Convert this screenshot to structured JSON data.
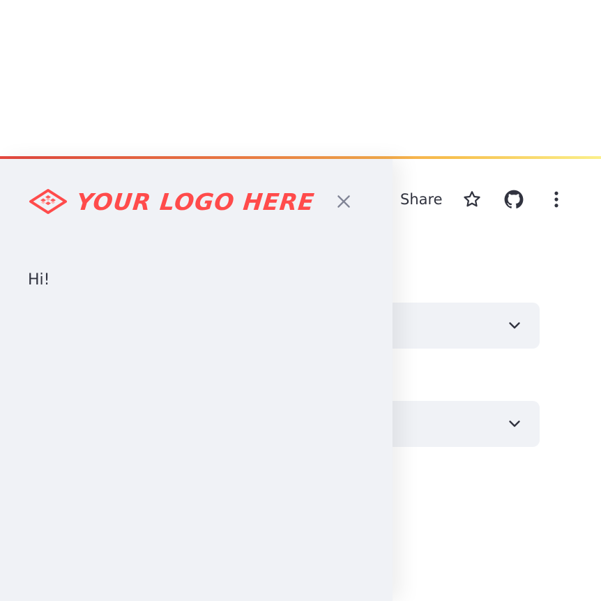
{
  "header": {
    "share_label": "Share",
    "icons": [
      "star-icon",
      "github-icon",
      "more-vertical-icon"
    ]
  },
  "sidebar": {
    "logo_text": "YOUR LOGO HERE",
    "close_icon": "close-icon",
    "content_text": "Hi!"
  },
  "main": {
    "expanders": [
      {
        "icon": "chevron-down-icon"
      },
      {
        "icon": "chevron-down-icon"
      }
    ]
  },
  "colors": {
    "accent": "#ff4b4b",
    "sidebar_bg": "#f0f2f6",
    "text": "#31333f",
    "gradient": [
      "#e4473f",
      "#f7c04f",
      "#fbf08a"
    ]
  }
}
